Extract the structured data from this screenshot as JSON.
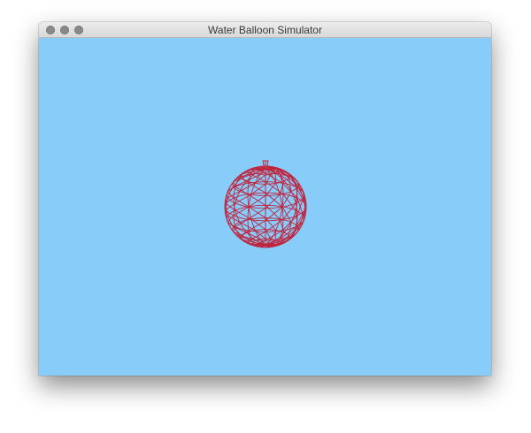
{
  "window": {
    "title": "Water Balloon Simulator"
  },
  "titlebar": {
    "buttons": [
      "close-button",
      "minimize-button",
      "zoom-button"
    ]
  },
  "scene": {
    "background_color": "#88ccf9",
    "balloon": {
      "wireframe_color": "#c0243c",
      "latitude_rings": 10,
      "longitude_segments": 14
    }
  }
}
